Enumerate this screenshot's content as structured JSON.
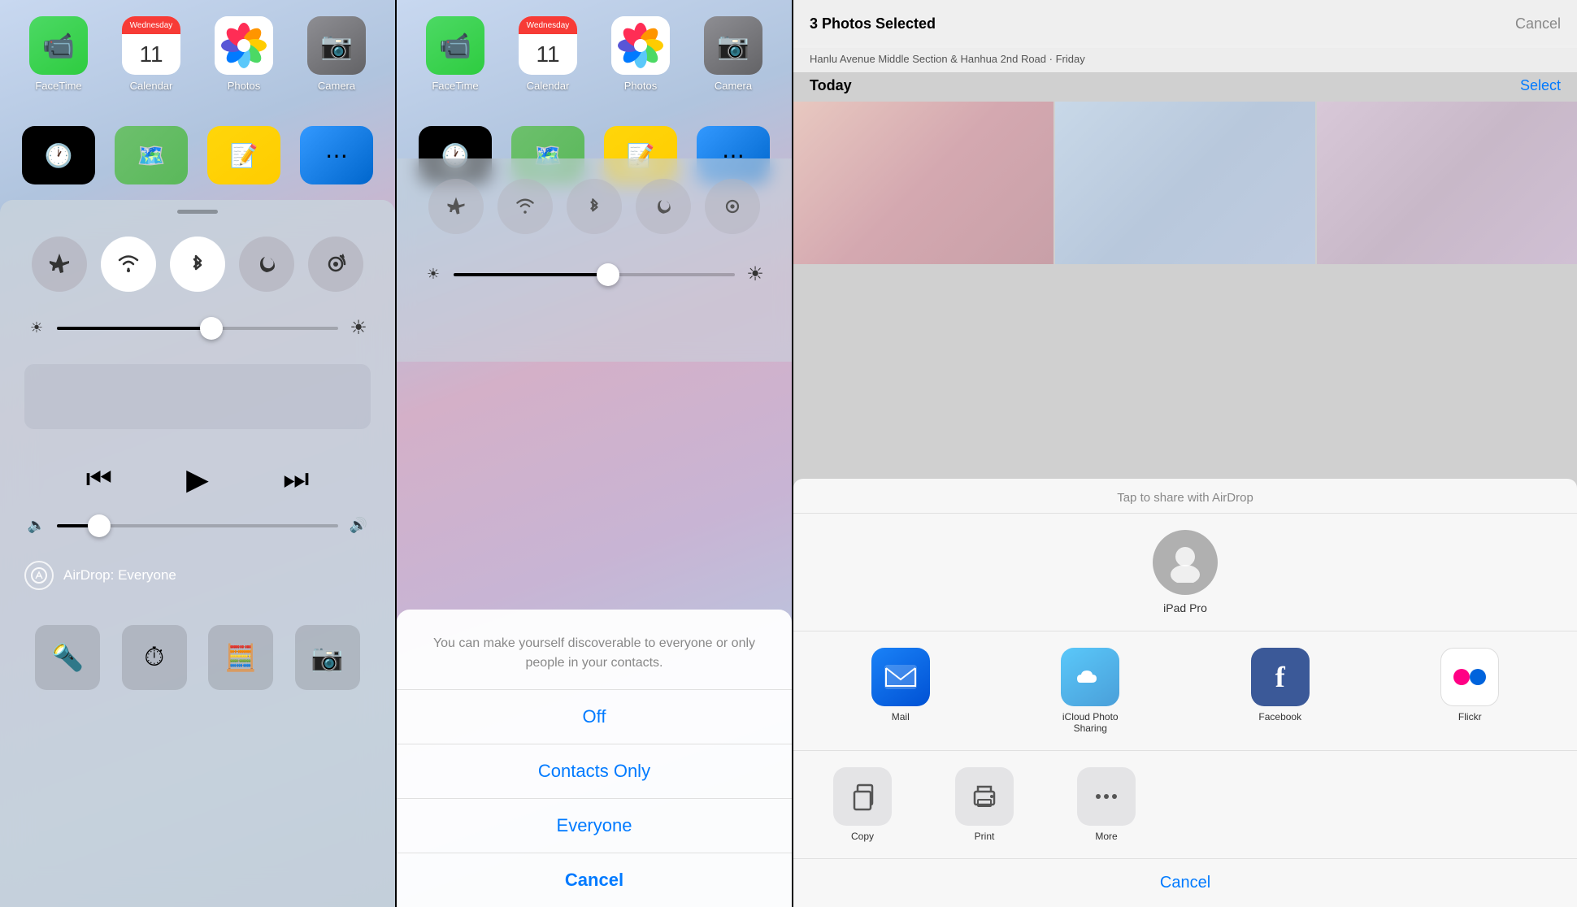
{
  "panel1": {
    "apps_row1": [
      {
        "id": "facetime",
        "label": "FaceTime",
        "icon_char": "📹"
      },
      {
        "id": "calendar",
        "label": "Calendar",
        "day_label": "Wednesday",
        "day_num": "11"
      },
      {
        "id": "photos",
        "label": "Photos"
      },
      {
        "id": "camera",
        "label": "Camera",
        "icon_char": "📷"
      }
    ],
    "control_center": {
      "airdrop_label": "AirDrop: Everyone",
      "brightness_position": "55",
      "volume_position": "15"
    }
  },
  "panel2": {
    "airdrop_sheet": {
      "message": "You can make yourself discoverable to everyone or only people in your contacts.",
      "option_off": "Off",
      "option_contacts": "Contacts Only",
      "option_everyone": "Everyone",
      "cancel": "Cancel"
    }
  },
  "panel3": {
    "header": {
      "title": "3 Photos Selected",
      "cancel_label": "Cancel"
    },
    "subtitle": "Hanlu Avenue Middle Section & Hanhua 2nd Road · Friday",
    "today_label": "Today",
    "select_label": "Select",
    "share_sheet": {
      "airdrop_header": "Tap to share with AirDrop",
      "device_name": "iPad Pro",
      "apps": [
        {
          "id": "mail",
          "label": "Mail"
        },
        {
          "id": "icloud",
          "label": "iCloud Photo Sharing"
        },
        {
          "id": "facebook",
          "label": "Facebook"
        },
        {
          "id": "flickr",
          "label": "Flickr"
        }
      ],
      "actions": [
        {
          "id": "copy",
          "label": "Copy"
        },
        {
          "id": "print",
          "label": "Print"
        },
        {
          "id": "more",
          "label": "More"
        }
      ],
      "cancel_label": "Cancel"
    }
  }
}
